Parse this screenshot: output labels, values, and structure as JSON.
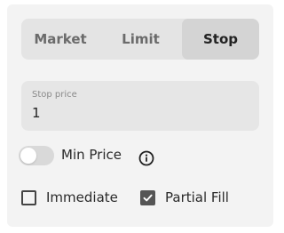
{
  "order_type_tabs": [
    {
      "label": "Market",
      "active": false
    },
    {
      "label": "Limit",
      "active": false
    },
    {
      "label": "Stop",
      "active": true
    }
  ],
  "stop_price": {
    "label": "Stop price",
    "value": "1"
  },
  "min_price_toggle": {
    "label": "Min Price",
    "on": false,
    "info_icon": "info-icon"
  },
  "options": [
    {
      "label": "Immediate",
      "checked": false
    },
    {
      "label": "Partial Fill",
      "checked": true
    }
  ],
  "colors": {
    "panel_bg": "#f3f3f3",
    "tab_active_bg": "#d4d4d4",
    "tab_bg": "#e4e4e4",
    "field_bg": "#e6e6e6",
    "checkbox_checked": "#555555"
  }
}
